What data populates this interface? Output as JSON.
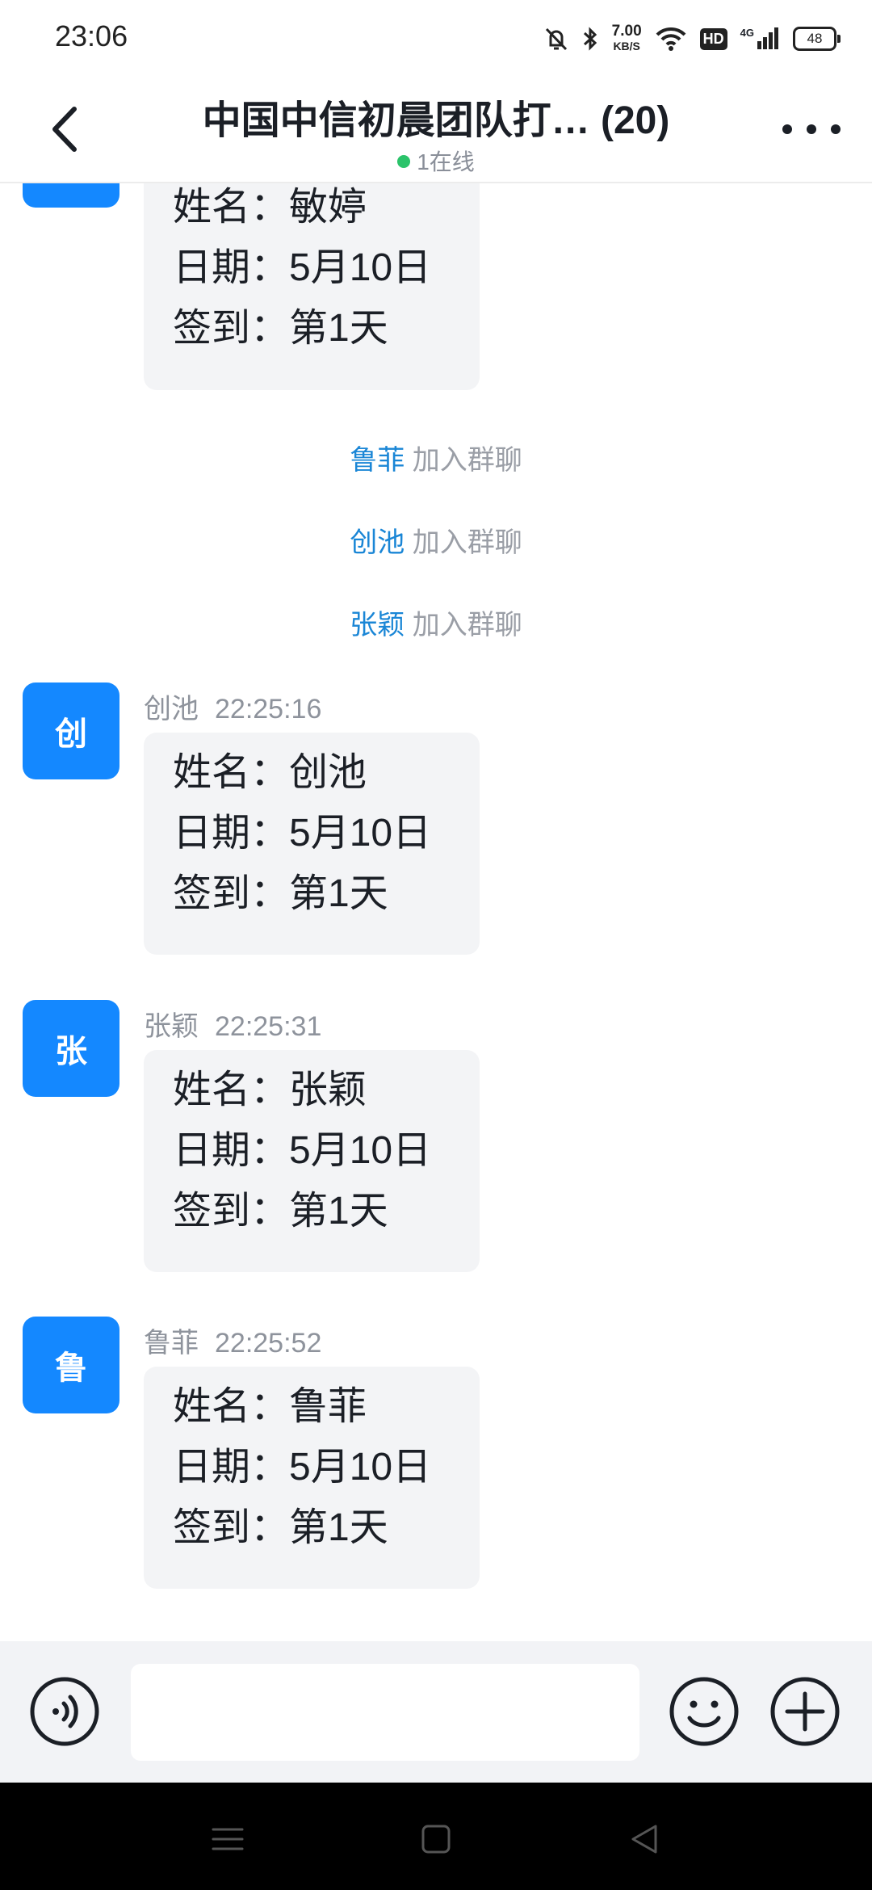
{
  "status_bar": {
    "time": "23:06",
    "net_speed_value": "7.00",
    "net_speed_unit": "KB/S",
    "hd_label": "HD",
    "network_label": "4G",
    "battery": "48"
  },
  "header": {
    "title": "中国中信初晨团队打… (20)",
    "online_status": "1在线"
  },
  "messages": [
    {
      "type": "bubble",
      "lines": [
        "姓名：敏婷",
        "日期：5月10日",
        "签到：第1天"
      ]
    },
    {
      "type": "system",
      "name": "鲁菲",
      "text": "加入群聊"
    },
    {
      "type": "system",
      "name": "创池",
      "text": "加入群聊"
    },
    {
      "type": "system",
      "name": "张颖",
      "text": "加入群聊"
    },
    {
      "type": "message",
      "avatar": "创",
      "sender": "创池",
      "time": "22:25:16",
      "lines": [
        "姓名：创池",
        "日期：5月10日",
        "签到：第1天"
      ]
    },
    {
      "type": "message",
      "avatar": "张",
      "sender": "张颖",
      "time": "22:25:31",
      "lines": [
        "姓名：张颖",
        "日期：5月10日",
        "签到：第1天"
      ]
    },
    {
      "type": "message",
      "avatar": "鲁",
      "sender": "鲁菲",
      "time": "22:25:52",
      "lines": [
        "姓名：鲁菲",
        "日期：5月10日",
        "签到：第1天"
      ]
    }
  ],
  "input_bar": {
    "value": "",
    "placeholder": ""
  },
  "colors": {
    "accent": "#1488ff",
    "online_dot": "#2bc36a",
    "system_name": "#1a86d6"
  },
  "icons": {
    "back": "chevron-left-icon",
    "more": "more-dots-icon",
    "voice": "voice-icon",
    "emoji": "emoji-icon",
    "plus": "plus-icon"
  }
}
